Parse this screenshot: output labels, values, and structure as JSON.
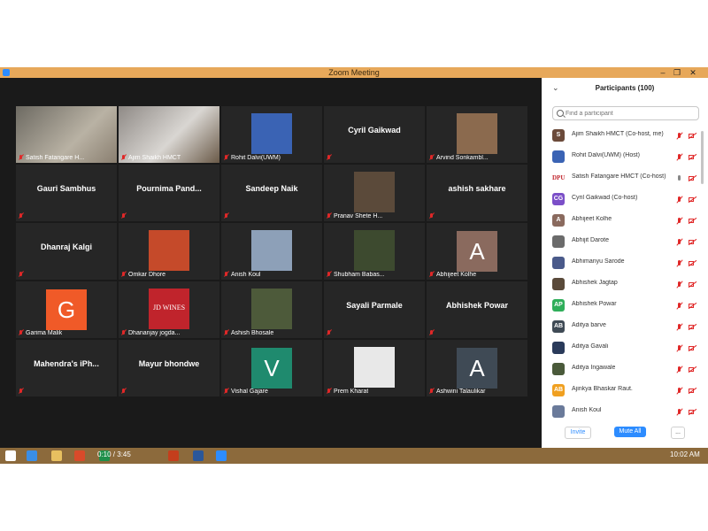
{
  "window": {
    "title": "Zoom Meeting",
    "controls": [
      "–",
      "❐",
      "✕"
    ]
  },
  "tiles": [
    {
      "name": "Satish Fatangare H...",
      "kind": "video",
      "active": true
    },
    {
      "name": "Ajim Shaikh HMCT",
      "kind": "video"
    },
    {
      "name": "Rohit Dalvi(UWM)",
      "kind": "logo",
      "color": "#3a63b4"
    },
    {
      "name": "Cyril Gaikwad",
      "kind": "text"
    },
    {
      "name": "Arvind Sonkambl...",
      "kind": "photo",
      "color": "#8b6a4e"
    },
    {
      "name": "Gauri Sambhus",
      "kind": "text"
    },
    {
      "name": "Pournima  Pand...",
      "kind": "text"
    },
    {
      "name": "Sandeep Naik",
      "kind": "text"
    },
    {
      "name": "Pranav Shete H...",
      "kind": "photo",
      "color": "#5b4a3a"
    },
    {
      "name": "ashish sakhare",
      "kind": "text"
    },
    {
      "name": "Dhanraj Kalgi",
      "kind": "text"
    },
    {
      "name": "Omkar Dhore",
      "kind": "photo",
      "color": "#c54a2a"
    },
    {
      "name": "Anish Koul",
      "kind": "photo",
      "color": "#8da0b8"
    },
    {
      "name": "Shubham Babas...",
      "kind": "photo",
      "color": "#3d4a2f"
    },
    {
      "name": "Abhijeet Kolhe",
      "kind": "letter",
      "letter": "A",
      "color": "#8a6a5e"
    },
    {
      "name": "Garima Malik",
      "kind": "letter",
      "letter": "G",
      "color": "#f05a28"
    },
    {
      "name": "Dhananjay jogda...",
      "kind": "logo",
      "text": "JD WINES",
      "color": "#c0242c"
    },
    {
      "name": "Ashish Bhosale",
      "kind": "photo",
      "color": "#4d5a3a"
    },
    {
      "name": "Sayali Parmale",
      "kind": "text"
    },
    {
      "name": "Abhishek Powar",
      "kind": "text"
    },
    {
      "name": "Mahendra's  iPh...",
      "kind": "text"
    },
    {
      "name": "Mayur bhondwe",
      "kind": "text"
    },
    {
      "name": "Vishal Gajare",
      "kind": "letter",
      "letter": "V",
      "color": "#1f8a6e"
    },
    {
      "name": "Prem Kharat",
      "kind": "photo",
      "color": "#e8e8e8"
    },
    {
      "name": "Ashwini Talaulikar",
      "kind": "letter",
      "letter": "A",
      "color": "#3f4a55"
    }
  ],
  "tile_labels": {
    "Cyril Gaikwad": "",
    "Gauri Sambhus": "",
    "Pournima  Pand...": "",
    "Sandeep Naik": "",
    "ashish sakhare": "",
    "Dhanraj Kalgi": "",
    "Sayali Parmale": "",
    "Abhishek Powar": "",
    "Mahendra's  iPh...": "",
    "Mayur bhondwe": ""
  },
  "panel": {
    "title": "Participants (100)",
    "search_placeholder": "Find a participant",
    "participants": [
      {
        "name": "Ajim Shaikh HMCT (Co-host, me)",
        "avatar": "S",
        "color": "#6b4a3a",
        "mic": "muted"
      },
      {
        "name": "Rohit Dalvi(UWM) (Host)",
        "avatar": "",
        "color": "#3a63b4",
        "mic": "muted"
      },
      {
        "name": "Satish Fatangare HMCT (Co-host)",
        "avatar": "DPU",
        "color": "#ffffff",
        "mic": "on"
      },
      {
        "name": "Cyril Gaikwad (Co-host)",
        "avatar": "CG",
        "color": "#7b4fc8",
        "mic": "muted"
      },
      {
        "name": "Abhijeet Kolhe",
        "avatar": "A",
        "color": "#8a6a5e",
        "mic": "muted"
      },
      {
        "name": "Abhijit Darote",
        "avatar": "",
        "color": "#6b6b6b",
        "mic": "muted"
      },
      {
        "name": "Abhimanyu Sarode",
        "avatar": "",
        "color": "#4a5a8a",
        "mic": "muted"
      },
      {
        "name": "Abhishek Jagtap",
        "avatar": "",
        "color": "#5a4a3a",
        "mic": "muted"
      },
      {
        "name": "Abhishek Powar",
        "avatar": "AP",
        "color": "#2fae5a",
        "mic": "muted"
      },
      {
        "name": "Aditya barve",
        "avatar": "AB",
        "color": "#3f4a55",
        "mic": "muted"
      },
      {
        "name": "Aditya Gavali",
        "avatar": "",
        "color": "#2a3a5a",
        "mic": "muted"
      },
      {
        "name": "Aditya Ingawale",
        "avatar": "",
        "color": "#4a5a3a",
        "mic": "muted"
      },
      {
        "name": "Ajinkya Bhaskar Raut.",
        "avatar": "AB",
        "color": "#f0a020",
        "mic": "muted"
      },
      {
        "name": "Anish Koul",
        "avatar": "",
        "color": "#6a7a9a",
        "mic": "muted"
      }
    ],
    "buttons": {
      "invite": "Invite",
      "mute_all": "Mute All",
      "more": "..."
    }
  },
  "taskbar": {
    "media_time": "0:10 / 3:45",
    "clock": "10:02 AM"
  },
  "colors": {
    "accent": "#2d8cff",
    "mic_muted": "#e02828",
    "titlebar": "#e7a85a",
    "taskbar": "#8c6a3c"
  }
}
